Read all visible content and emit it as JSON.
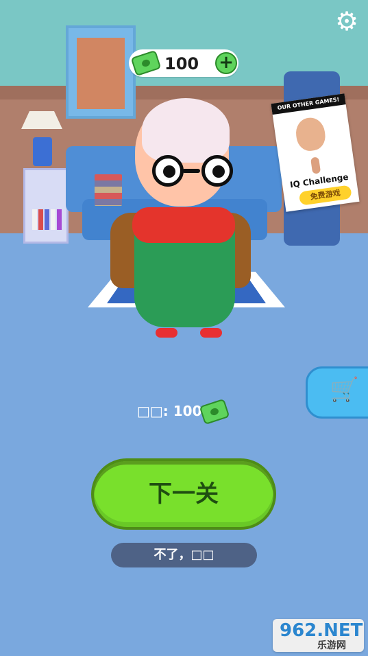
{
  "top_currency": {
    "amount": "100",
    "plus_label": "+"
  },
  "advert": {
    "header": "OUR OTHER GAMES!",
    "title": "IQ Challenge",
    "cta": "免费游戏"
  },
  "reward": {
    "label": "□□: 100"
  },
  "buttons": {
    "next_level": "下一关",
    "skip": "不了，□□"
  },
  "icons": {
    "settings": "gear-icon",
    "cart": "shopping-cart-icon",
    "cash": "cash-icon",
    "plus": "plus-icon"
  },
  "watermark": {
    "main_prefix": "962",
    "main_suffix": ".NET",
    "sub": "乐游网"
  },
  "colors": {
    "primary_button": "#79e02c",
    "secondary_button": "#4e6286",
    "shop_button": "#4bbcf2",
    "cash": "#5fd45c"
  }
}
